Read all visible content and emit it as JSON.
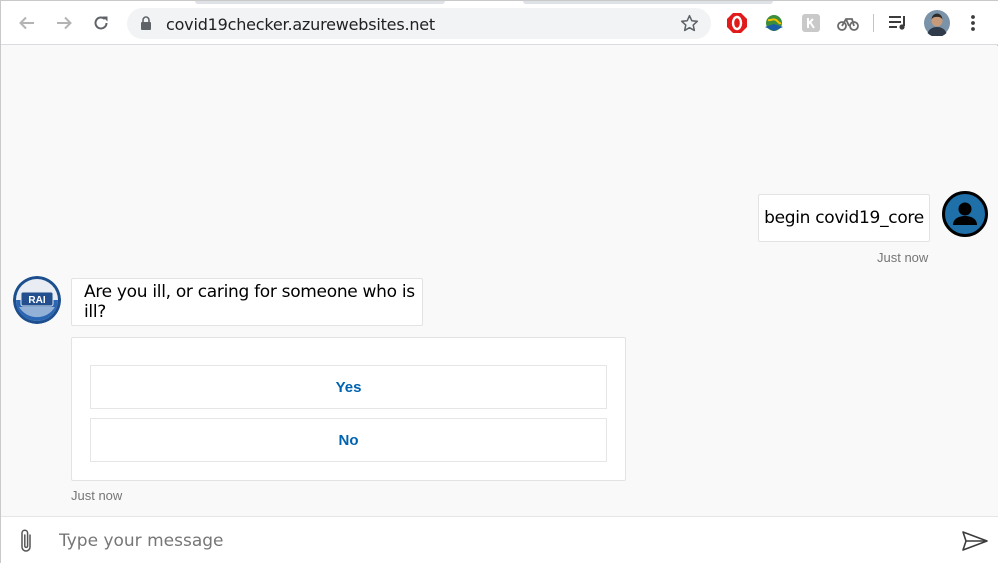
{
  "browser": {
    "url": "covid19checker.azurewebsites.net",
    "icons": [
      "back-arrow-icon",
      "forward-arrow-icon",
      "reload-icon",
      "lock-icon",
      "star-icon",
      "opera-stop-extension-icon",
      "globe-extension-icon",
      "k-extension-icon",
      "bicycle-extension-icon",
      "media-queue-icon",
      "profile-avatar",
      "more-vert-icon"
    ]
  },
  "chat": {
    "user_message": "begin covid19_core",
    "user_timestamp": "Just now",
    "bot_avatar_label": "RAI",
    "bot_message": "Are you ill, or caring for someone who is ill?",
    "choices": [
      {
        "label": "Yes"
      },
      {
        "label": "No"
      }
    ],
    "bot_timestamp": "Just now"
  },
  "sendbox": {
    "placeholder": "Type your message"
  },
  "colors": {
    "accent": "#0063b1",
    "timestamp": "#767676",
    "user_avatar": "#1f6fa8"
  }
}
